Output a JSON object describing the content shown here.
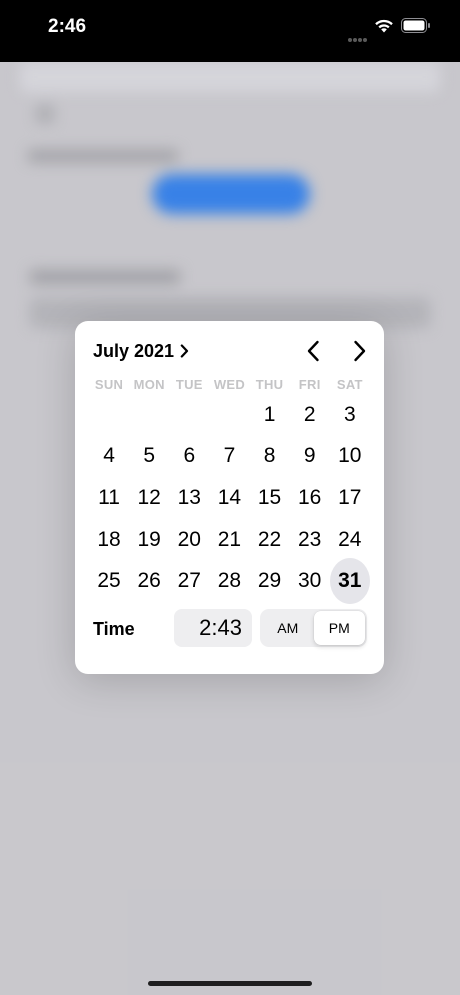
{
  "status_bar": {
    "time": "2:46",
    "icons": [
      "signal-dots-icon",
      "wifi-icon",
      "battery-icon"
    ]
  },
  "picker": {
    "month_label": "July 2021",
    "prev_icon": "chevron-left-icon",
    "next_icon": "chevron-right-icon",
    "weekdays": [
      "SUN",
      "MON",
      "TUE",
      "WED",
      "THU",
      "FRI",
      "SAT"
    ],
    "leading_blank_days": 4,
    "days": [
      "1",
      "2",
      "3",
      "4",
      "5",
      "6",
      "7",
      "8",
      "9",
      "10",
      "11",
      "12",
      "13",
      "14",
      "15",
      "16",
      "17",
      "18",
      "19",
      "20",
      "21",
      "22",
      "23",
      "24",
      "25",
      "26",
      "27",
      "28",
      "29",
      "30",
      "31"
    ],
    "selected_day": "31",
    "time_label": "Time",
    "time_value": "2:43",
    "am_label": "AM",
    "pm_label": "PM",
    "selected_period": "PM"
  },
  "colors": {
    "accent_blue": "#3478f6",
    "selected_day_bg": "#e5e5ea",
    "weekday_text": "#c4c4c6"
  }
}
